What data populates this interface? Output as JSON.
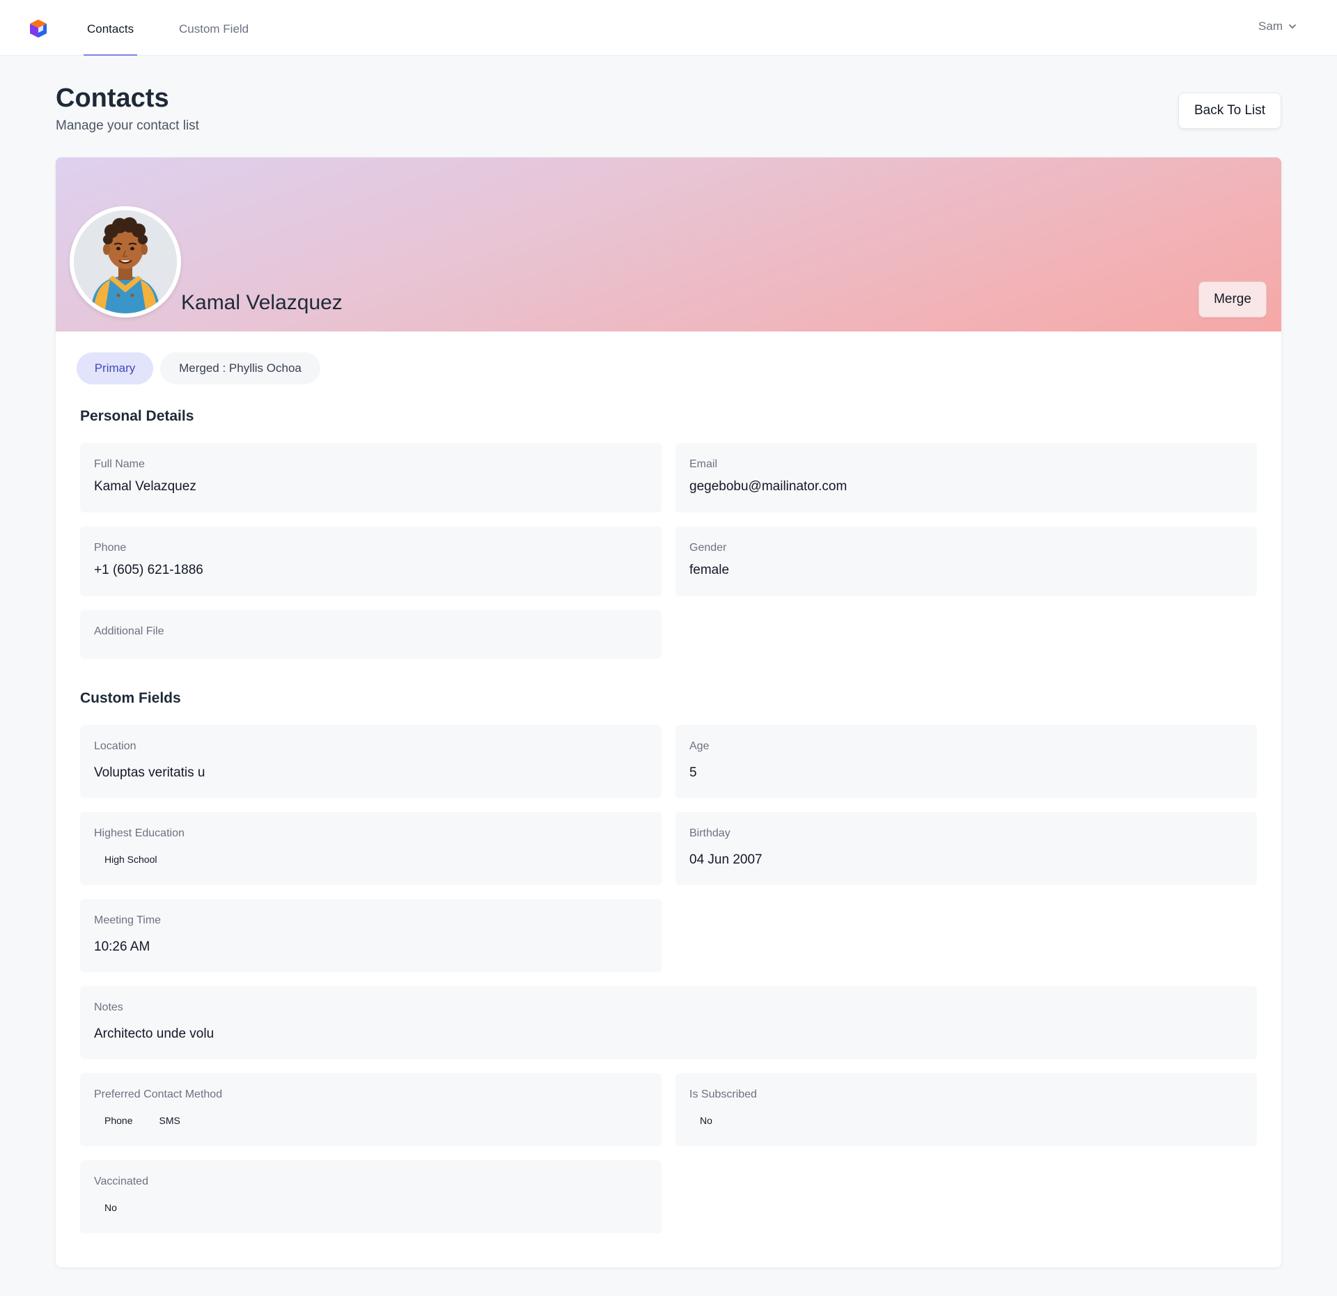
{
  "nav": {
    "tabs": [
      {
        "label": "Contacts",
        "active": true
      },
      {
        "label": "Custom Field",
        "active": false
      }
    ],
    "user": "Sam"
  },
  "header": {
    "title": "Contacts",
    "subtitle": "Manage your contact list",
    "back_label": "Back To List"
  },
  "profile": {
    "name": "Kamal Velazquez",
    "merge_label": "Merge",
    "tabs": [
      "Primary",
      "Merged : Phyllis Ochoa"
    ]
  },
  "personal": {
    "title": "Personal Details",
    "full_name": {
      "label": "Full Name",
      "value": "Kamal Velazquez"
    },
    "email": {
      "label": "Email",
      "value": "gegebobu@mailinator.com"
    },
    "phone": {
      "label": "Phone",
      "value": "+1 (605) 621-1886"
    },
    "gender": {
      "label": "Gender",
      "value": "female"
    },
    "additional_file": {
      "label": "Additional File"
    }
  },
  "custom": {
    "title": "Custom Fields",
    "location": {
      "label": "Location",
      "value": "Voluptas veritatis u"
    },
    "age": {
      "label": "Age",
      "value": "5"
    },
    "education": {
      "label": "Highest Education",
      "values": [
        "High School"
      ]
    },
    "birthday": {
      "label": "Birthday",
      "value": "04 Jun 2007"
    },
    "meeting_time": {
      "label": "Meeting Time",
      "value": "10:26 AM"
    },
    "notes": {
      "label": "Notes",
      "value": "Architecto unde volu"
    },
    "contact_method": {
      "label": "Preferred Contact Method",
      "values": [
        "Phone",
        "SMS"
      ]
    },
    "subscribed": {
      "label": "Is Subscribed",
      "values": [
        "No"
      ]
    },
    "vaccinated": {
      "label": "Vaccinated",
      "values": [
        "No"
      ]
    }
  },
  "colors": {
    "accent": "#7c83e8",
    "primary_pill_bg": "#e1e4fb",
    "primary_pill_text": "#4149b8",
    "banner_start": "#ddd1f0",
    "banner_end": "#f5a8a6"
  },
  "icons": {
    "logo": "cube-logo-icon",
    "user_menu": "chevron-down-icon"
  }
}
